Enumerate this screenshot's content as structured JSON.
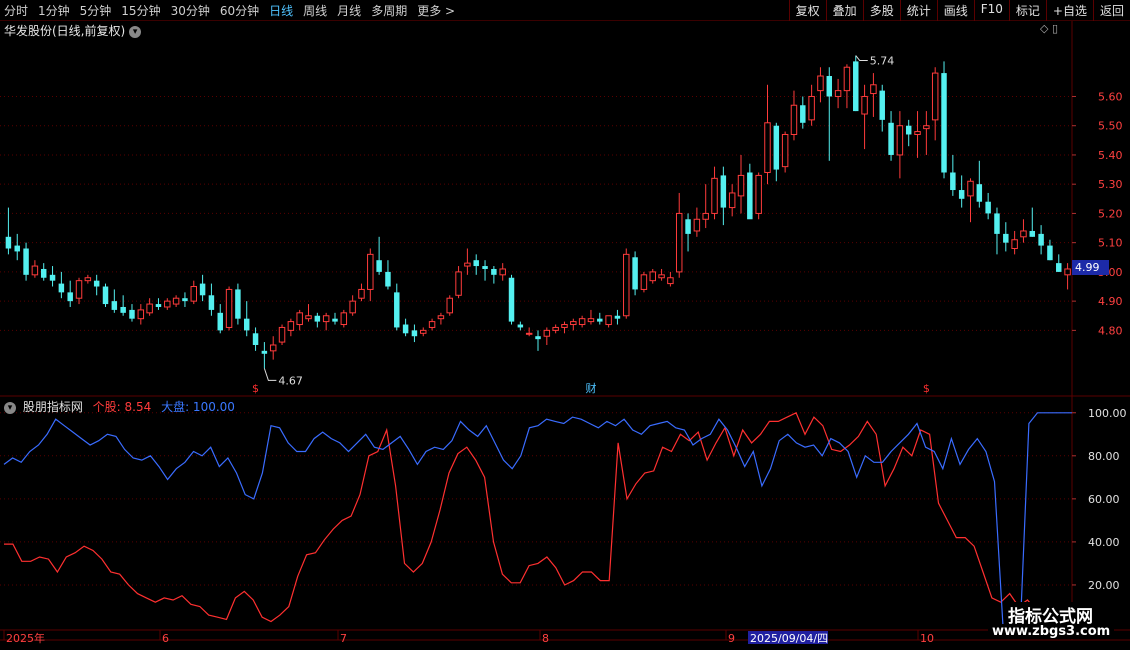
{
  "toolbar": {
    "periods": [
      "分时",
      "1分钟",
      "5分钟",
      "15分钟",
      "30分钟",
      "60分钟",
      "日线",
      "周线",
      "月线",
      "多周期",
      "更多 >"
    ],
    "active_period": "日线",
    "right_buttons": [
      "复权",
      "叠加",
      "多股",
      "统计",
      "画线",
      "F10",
      "标记",
      "+自选",
      "返回"
    ]
  },
  "chart_title": "华发股份(日线,前复权)",
  "price_axis": [
    "5.60",
    "5.50",
    "5.40",
    "5.30",
    "5.20",
    "5.10",
    "5.00",
    "4.90",
    "4.80"
  ],
  "current_price": "4.99",
  "annotations": {
    "high": "5.74",
    "low": "4.67"
  },
  "markers": {
    "cai": "财",
    "s1": "$",
    "s2": "$"
  },
  "indicator": {
    "name": "股朋指标网",
    "stock_label": "个股: 8.54",
    "market_label": "大盘: 100.00",
    "axis": [
      "100.00",
      "80.00",
      "60.00",
      "40.00",
      "20.00"
    ]
  },
  "date_axis": [
    "2025年",
    "6",
    "7",
    "8",
    "9",
    "10"
  ],
  "cursor_date": "2025/09/04/四",
  "watermark": {
    "line1": "指标公式网",
    "line2": "www.zbgs3.com"
  },
  "colors": {
    "up": "#ff3b3b",
    "down": "#54f0f0",
    "grid": "#5a0000",
    "stock_line": "#ff3030",
    "market_line": "#3a6cff",
    "cursor_bg": "#2020a0"
  },
  "chart_data": {
    "type": "candlestick",
    "ylim": [
      4.62,
      5.8
    ],
    "candles": [
      [
        5.12,
        5.22,
        5.06,
        5.08
      ],
      [
        5.09,
        5.13,
        5.04,
        5.07
      ],
      [
        5.08,
        5.1,
        4.97,
        4.99
      ],
      [
        4.99,
        5.04,
        4.98,
        5.02
      ],
      [
        5.01,
        5.03,
        4.97,
        4.98
      ],
      [
        4.99,
        5.02,
        4.95,
        4.97
      ],
      [
        4.96,
        5.0,
        4.91,
        4.93
      ],
      [
        4.93,
        4.97,
        4.88,
        4.9
      ],
      [
        4.91,
        4.98,
        4.89,
        4.97
      ],
      [
        4.97,
        4.99,
        4.96,
        4.98
      ],
      [
        4.97,
        4.99,
        4.92,
        4.95
      ],
      [
        4.95,
        4.96,
        4.88,
        4.89
      ],
      [
        4.9,
        4.94,
        4.86,
        4.87
      ],
      [
        4.88,
        4.92,
        4.85,
        4.86
      ],
      [
        4.87,
        4.89,
        4.83,
        4.84
      ],
      [
        4.84,
        4.89,
        4.82,
        4.87
      ],
      [
        4.86,
        4.91,
        4.85,
        4.89
      ],
      [
        4.89,
        4.91,
        4.87,
        4.88
      ],
      [
        4.88,
        4.91,
        4.87,
        4.9
      ],
      [
        4.89,
        4.92,
        4.88,
        4.91
      ],
      [
        4.91,
        4.93,
        4.88,
        4.9
      ],
      [
        4.9,
        4.97,
        4.89,
        4.95
      ],
      [
        4.96,
        4.99,
        4.9,
        4.92
      ],
      [
        4.92,
        4.96,
        4.85,
        4.87
      ],
      [
        4.86,
        4.89,
        4.79,
        4.8
      ],
      [
        4.81,
        4.95,
        4.8,
        4.94
      ],
      [
        4.94,
        4.96,
        4.82,
        4.84
      ],
      [
        4.84,
        4.9,
        4.78,
        4.8
      ],
      [
        4.79,
        4.81,
        4.73,
        4.75
      ],
      [
        4.73,
        4.76,
        4.67,
        4.72
      ],
      [
        4.73,
        4.78,
        4.7,
        4.75
      ],
      [
        4.76,
        4.82,
        4.75,
        4.81
      ],
      [
        4.8,
        4.84,
        4.78,
        4.83
      ],
      [
        4.82,
        4.87,
        4.8,
        4.86
      ],
      [
        4.84,
        4.89,
        4.83,
        4.85
      ],
      [
        4.85,
        4.86,
        4.81,
        4.83
      ],
      [
        4.83,
        4.86,
        4.8,
        4.85
      ],
      [
        4.84,
        4.86,
        4.82,
        4.83
      ],
      [
        4.82,
        4.87,
        4.81,
        4.86
      ],
      [
        4.86,
        4.92,
        4.85,
        4.9
      ],
      [
        4.91,
        4.96,
        4.9,
        4.94
      ],
      [
        4.94,
        5.08,
        4.9,
        5.06
      ],
      [
        5.04,
        5.12,
        4.99,
        5.0
      ],
      [
        5.0,
        5.04,
        4.94,
        4.95
      ],
      [
        4.93,
        4.96,
        4.8,
        4.81
      ],
      [
        4.82,
        4.84,
        4.78,
        4.79
      ],
      [
        4.8,
        4.82,
        4.76,
        4.78
      ],
      [
        4.79,
        4.81,
        4.78,
        4.8
      ],
      [
        4.81,
        4.84,
        4.8,
        4.83
      ],
      [
        4.84,
        4.86,
        4.82,
        4.85
      ],
      [
        4.86,
        4.92,
        4.85,
        4.91
      ],
      [
        4.92,
        5.02,
        4.91,
        5.0
      ],
      [
        5.02,
        5.08,
        4.99,
        5.03
      ],
      [
        5.04,
        5.06,
        4.99,
        5.02
      ],
      [
        5.02,
        5.04,
        4.97,
        5.01
      ],
      [
        5.01,
        5.02,
        4.96,
        4.99
      ],
      [
        4.99,
        5.03,
        4.97,
        5.01
      ],
      [
        4.98,
        4.99,
        4.82,
        4.83
      ],
      [
        4.82,
        4.83,
        4.8,
        4.81
      ],
      [
        4.79,
        4.81,
        4.78,
        4.79
      ],
      [
        4.78,
        4.8,
        4.73,
        4.77
      ],
      [
        4.78,
        4.81,
        4.75,
        4.8
      ],
      [
        4.8,
        4.82,
        4.79,
        4.81
      ],
      [
        4.81,
        4.83,
        4.79,
        4.82
      ],
      [
        4.82,
        4.84,
        4.8,
        4.83
      ],
      [
        4.82,
        4.85,
        4.81,
        4.84
      ],
      [
        4.83,
        4.87,
        4.82,
        4.84
      ],
      [
        4.84,
        4.86,
        4.82,
        4.83
      ],
      [
        4.82,
        4.85,
        4.81,
        4.85
      ],
      [
        4.85,
        4.87,
        4.82,
        4.84
      ],
      [
        4.85,
        5.08,
        4.84,
        5.06
      ],
      [
        5.05,
        5.07,
        4.92,
        4.94
      ],
      [
        4.94,
        5.0,
        4.93,
        4.99
      ],
      [
        4.97,
        5.01,
        4.96,
        5.0
      ],
      [
        4.98,
        5.01,
        4.97,
        4.99
      ],
      [
        4.96,
        5.0,
        4.95,
        4.98
      ],
      [
        5.0,
        5.27,
        4.98,
        5.2
      ],
      [
        5.18,
        5.2,
        5.07,
        5.13
      ],
      [
        5.14,
        5.22,
        5.12,
        5.18
      ],
      [
        5.18,
        5.3,
        5.15,
        5.2
      ],
      [
        5.2,
        5.36,
        5.18,
        5.32
      ],
      [
        5.33,
        5.36,
        5.16,
        5.22
      ],
      [
        5.22,
        5.3,
        5.19,
        5.27
      ],
      [
        5.26,
        5.4,
        5.2,
        5.33
      ],
      [
        5.34,
        5.37,
        5.22,
        5.18
      ],
      [
        5.2,
        5.34,
        5.18,
        5.33
      ],
      [
        5.34,
        5.64,
        5.3,
        5.51
      ],
      [
        5.5,
        5.51,
        5.31,
        5.35
      ],
      [
        5.36,
        5.48,
        5.34,
        5.47
      ],
      [
        5.47,
        5.62,
        5.45,
        5.57
      ],
      [
        5.57,
        5.6,
        5.49,
        5.51
      ],
      [
        5.52,
        5.64,
        5.5,
        5.6
      ],
      [
        5.62,
        5.7,
        5.58,
        5.67
      ],
      [
        5.67,
        5.7,
        5.38,
        5.6
      ],
      [
        5.6,
        5.66,
        5.56,
        5.62
      ],
      [
        5.62,
        5.71,
        5.56,
        5.7
      ],
      [
        5.72,
        5.74,
        5.55,
        5.55
      ],
      [
        5.54,
        5.64,
        5.42,
        5.6
      ],
      [
        5.61,
        5.68,
        5.53,
        5.64
      ],
      [
        5.62,
        5.64,
        5.48,
        5.52
      ],
      [
        5.51,
        5.55,
        5.38,
        5.4
      ],
      [
        5.4,
        5.55,
        5.32,
        5.5
      ],
      [
        5.5,
        5.52,
        5.43,
        5.47
      ],
      [
        5.47,
        5.55,
        5.39,
        5.48
      ],
      [
        5.49,
        5.55,
        5.4,
        5.5
      ],
      [
        5.52,
        5.7,
        5.45,
        5.68
      ],
      [
        5.68,
        5.72,
        5.32,
        5.34
      ],
      [
        5.34,
        5.4,
        5.26,
        5.28
      ],
      [
        5.28,
        5.33,
        5.22,
        5.25
      ],
      [
        5.26,
        5.32,
        5.17,
        5.31
      ],
      [
        5.3,
        5.38,
        5.22,
        5.24
      ],
      [
        5.24,
        5.27,
        5.18,
        5.2
      ],
      [
        5.2,
        5.22,
        5.06,
        5.13
      ],
      [
        5.13,
        5.17,
        5.07,
        5.1
      ],
      [
        5.08,
        5.14,
        5.06,
        5.11
      ],
      [
        5.12,
        5.18,
        5.1,
        5.14
      ],
      [
        5.14,
        5.22,
        5.12,
        5.12
      ],
      [
        5.13,
        5.16,
        5.06,
        5.09
      ],
      [
        5.09,
        5.11,
        5.04,
        5.04
      ],
      [
        5.03,
        5.06,
        5.0,
        5.0
      ],
      [
        4.99,
        5.03,
        4.94,
        5.01
      ]
    ],
    "indicator_series": [
      {
        "name": "个股",
        "color": "#ff3030",
        "range": [
          0,
          105
        ],
        "values": [
          39,
          39,
          31,
          31,
          33,
          32,
          26,
          33,
          35,
          38,
          36,
          32,
          26,
          25,
          20,
          16,
          14,
          12,
          14,
          13,
          15,
          11,
          10,
          6,
          5,
          4,
          14,
          17,
          13,
          5,
          3,
          6,
          10,
          24,
          34,
          35,
          41,
          46,
          50,
          52,
          62,
          80,
          82,
          92,
          66,
          30,
          26,
          30,
          40,
          55,
          72,
          81,
          84,
          78,
          70,
          40,
          25,
          21,
          21,
          29,
          30,
          33,
          28,
          20,
          22,
          26,
          26,
          22,
          22,
          86,
          60,
          67,
          72,
          73,
          84,
          82,
          90,
          87,
          91,
          78,
          86,
          93,
          80,
          92,
          86,
          90,
          96,
          96,
          98,
          100,
          90,
          98,
          94,
          83,
          82,
          85,
          89,
          96,
          90,
          66,
          74,
          84,
          80,
          92,
          90,
          58,
          50,
          42,
          42,
          38,
          26,
          14,
          12,
          16,
          10,
          13,
          8,
          6,
          4,
          2,
          1
        ]
      },
      {
        "name": "大盘",
        "color": "#3a6cff",
        "range": [
          0,
          105
        ],
        "values": [
          76,
          79,
          77,
          82,
          85,
          90,
          97,
          94,
          91,
          88,
          85,
          87,
          90,
          89,
          83,
          79,
          78,
          80,
          75,
          69,
          74,
          77,
          82,
          80,
          84,
          75,
          79,
          72,
          62,
          60,
          72,
          94,
          93,
          86,
          82,
          82,
          88,
          91,
          88,
          86,
          82,
          86,
          90,
          84,
          83,
          86,
          89,
          83,
          76,
          82,
          84,
          83,
          87,
          96,
          92,
          89,
          94,
          86,
          78,
          74,
          80,
          93,
          94,
          97,
          96,
          95,
          98,
          97,
          95,
          93,
          96,
          94,
          97,
          92,
          90,
          94,
          95,
          96,
          93,
          92,
          85,
          88,
          90,
          97,
          92,
          84,
          75,
          82,
          66,
          74,
          87,
          90,
          86,
          84,
          85,
          80,
          88,
          86,
          82,
          70,
          80,
          77,
          77,
          82,
          86,
          90,
          95,
          84,
          82,
          74,
          88,
          76,
          83,
          88,
          82,
          68,
          0,
          5,
          0,
          95,
          100,
          100,
          100,
          100,
          100
        ]
      }
    ]
  }
}
